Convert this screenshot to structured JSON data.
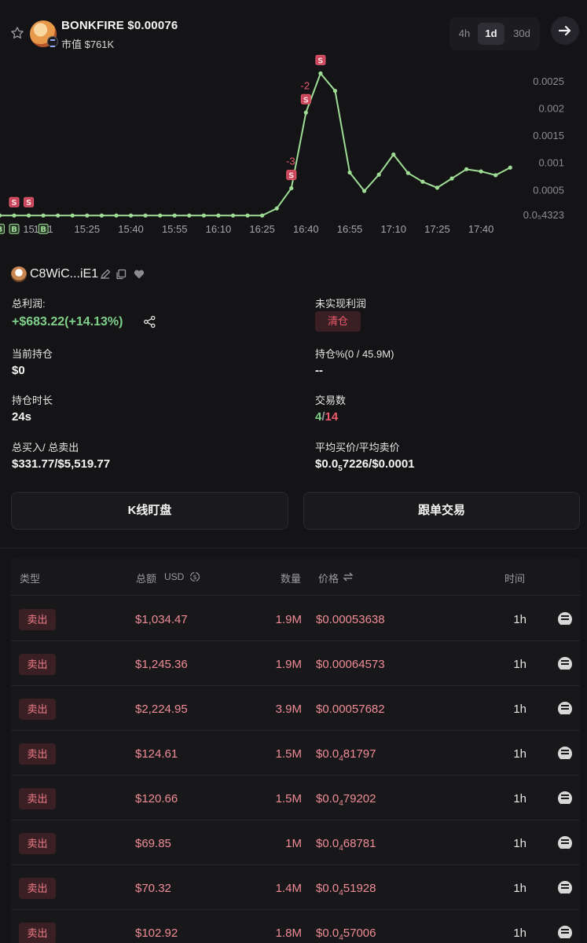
{
  "header": {
    "title": "BONKFIRE $0.00076",
    "mcap": "市值 $761K",
    "ranges": [
      "4h",
      "1d",
      "30d"
    ],
    "active_range": "1d"
  },
  "chart_data": {
    "type": "line",
    "color": "#9fdd96",
    "x_tick_labels": [
      "10",
      "15",
      "15:1",
      "15:25",
      "15:40",
      "15:55",
      "16:10",
      "16:25",
      "16:40",
      "16:55",
      "17:10",
      "17:25",
      "17:40"
    ],
    "y_tick_labels": [
      "0.0025",
      "0.002",
      "0.0015",
      "0.001",
      "0.0005",
      "0.0₅4323"
    ],
    "y_ticks": [
      0.0025,
      0.002,
      0.0015,
      0.001,
      0.0005,
      4.323e-05
    ],
    "ylim": [
      4.323e-05,
      0.0028
    ],
    "x_step_minutes": 5,
    "x_ticks_minutes": [
      -10,
      -5,
      0,
      15,
      30,
      45,
      60,
      75,
      90,
      105,
      120,
      135,
      150
    ],
    "x_minutes": [
      -20,
      -15,
      -10,
      -5,
      0,
      5,
      10,
      15,
      20,
      25,
      30,
      35,
      40,
      45,
      50,
      55,
      60,
      65,
      70,
      75,
      80,
      85,
      90,
      95,
      100,
      105,
      110,
      115,
      120,
      125,
      130,
      135,
      140,
      145,
      150,
      155,
      160
    ],
    "y": [
      4e-05,
      4e-05,
      4e-05,
      4e-05,
      4e-05,
      4e-05,
      4e-05,
      4e-05,
      4e-05,
      4e-05,
      4e-05,
      4e-05,
      4e-05,
      4e-05,
      4e-05,
      4e-05,
      4e-05,
      4e-05,
      4e-05,
      4e-05,
      0.00017,
      0.00054,
      0.00193,
      0.00265,
      0.00233,
      0.00083,
      0.00049,
      0.00079,
      0.00116,
      0.00082,
      0.00066,
      0.00055,
      0.00072,
      0.00089,
      0.00085,
      0.00078,
      0.00092
    ],
    "trade_markers": [
      {
        "x": -15,
        "label": "B"
      },
      {
        "x": -10,
        "label": "B"
      },
      {
        "x": -10,
        "label": "S"
      },
      {
        "x": -5,
        "label": "S"
      },
      {
        "x": 0,
        "label": "B"
      },
      {
        "x": 85,
        "label": "S",
        "note": "-3"
      },
      {
        "x": 90,
        "label": "S",
        "note": "-2"
      },
      {
        "x": 95,
        "label": "S"
      }
    ]
  },
  "wallet": {
    "address": "C8WiC...iE1"
  },
  "stats": {
    "total_profit_label": "总利润:",
    "total_profit_value": "+$683.22(+14.13%)",
    "unrealized_label": "未实现利润",
    "clear_label": "清仓",
    "holding_label": "当前持仓",
    "holding_value": "$0",
    "holding_pct_label": "持仓%(0 / 45.9M)",
    "holding_pct_value": "--",
    "duration_label": "持仓时长",
    "duration_value": "24s",
    "trades_label": "交易数",
    "trades_buys": "4",
    "trades_sep": "/",
    "trades_sells": "14",
    "buy_sell_label": "总买入/ 总卖出",
    "buy_sell_value": "$331.77/$5,519.77",
    "avg_price_label": "平均买价/平均卖价",
    "avg_price_prefix": "$0.0",
    "avg_price_sub": "5",
    "avg_price_rest": "7226/$0.0001"
  },
  "actions": {
    "kline_label": "K线盯盘",
    "copy_trade_label": "跟单交易"
  },
  "table": {
    "headers": {
      "type": "类型",
      "total": "总额",
      "currency": "USD",
      "qty": "数量",
      "price": "价格",
      "time": "时间"
    },
    "rows": [
      {
        "type": "卖出",
        "total": "$1,034.47",
        "qty": "1.9M",
        "price_prefix": "$0.00053638",
        "price_sub": "",
        "price_rest": "",
        "time": "1h"
      },
      {
        "type": "卖出",
        "total": "$1,245.36",
        "qty": "1.9M",
        "price_prefix": "$0.00064573",
        "price_sub": "",
        "price_rest": "",
        "time": "1h"
      },
      {
        "type": "卖出",
        "total": "$2,224.95",
        "qty": "3.9M",
        "price_prefix": "$0.00057682",
        "price_sub": "",
        "price_rest": "",
        "time": "1h"
      },
      {
        "type": "卖出",
        "total": "$124.61",
        "qty": "1.5M",
        "price_prefix": "$0.0",
        "price_sub": "4",
        "price_rest": "81797",
        "time": "1h"
      },
      {
        "type": "卖出",
        "total": "$120.66",
        "qty": "1.5M",
        "price_prefix": "$0.0",
        "price_sub": "4",
        "price_rest": "79202",
        "time": "1h"
      },
      {
        "type": "卖出",
        "total": "$69.85",
        "qty": "1M",
        "price_prefix": "$0.0",
        "price_sub": "4",
        "price_rest": "68781",
        "time": "1h"
      },
      {
        "type": "卖出",
        "total": "$70.32",
        "qty": "1.4M",
        "price_prefix": "$0.0",
        "price_sub": "4",
        "price_rest": "51928",
        "time": "1h"
      },
      {
        "type": "卖出",
        "total": "$102.92",
        "qty": "1.8M",
        "price_prefix": "$0.0",
        "price_sub": "4",
        "price_rest": "57006",
        "time": "1h"
      }
    ]
  }
}
